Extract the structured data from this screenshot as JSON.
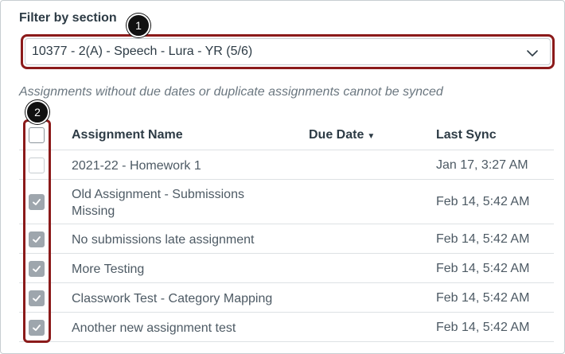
{
  "filter": {
    "label": "Filter by section",
    "selected": "10377 - 2(A) - Speech - Lura - YR (5/6)"
  },
  "callouts": {
    "one": "1",
    "two": "2"
  },
  "note": "Assignments without due dates or duplicate assignments cannot be synced",
  "table": {
    "headers": {
      "name": "Assignment Name",
      "due": "Due Date",
      "sync": "Last Sync"
    },
    "rows": [
      {
        "name": "2021-22 - Homework 1",
        "sync": "Jan 17, 3:27 AM",
        "checked": false
      },
      {
        "name": "Old Assignment - Submissions Missing",
        "sync": "Feb 14, 5:42 AM",
        "checked": true
      },
      {
        "name": "No submissions late assignment",
        "sync": "Feb 14, 5:42 AM",
        "checked": true
      },
      {
        "name": "More Testing",
        "sync": "Feb 14, 5:42 AM",
        "checked": true
      },
      {
        "name": "Classwork Test - Category Mapping",
        "sync": "Feb 14, 5:42 AM",
        "checked": true
      },
      {
        "name": "Another new assignment test",
        "sync": "Feb 14, 5:42 AM",
        "checked": true
      }
    ]
  },
  "colors": {
    "highlight": "#8b1a1a",
    "checked_fill": "#9ea6ad",
    "text": "#2d3b45"
  }
}
